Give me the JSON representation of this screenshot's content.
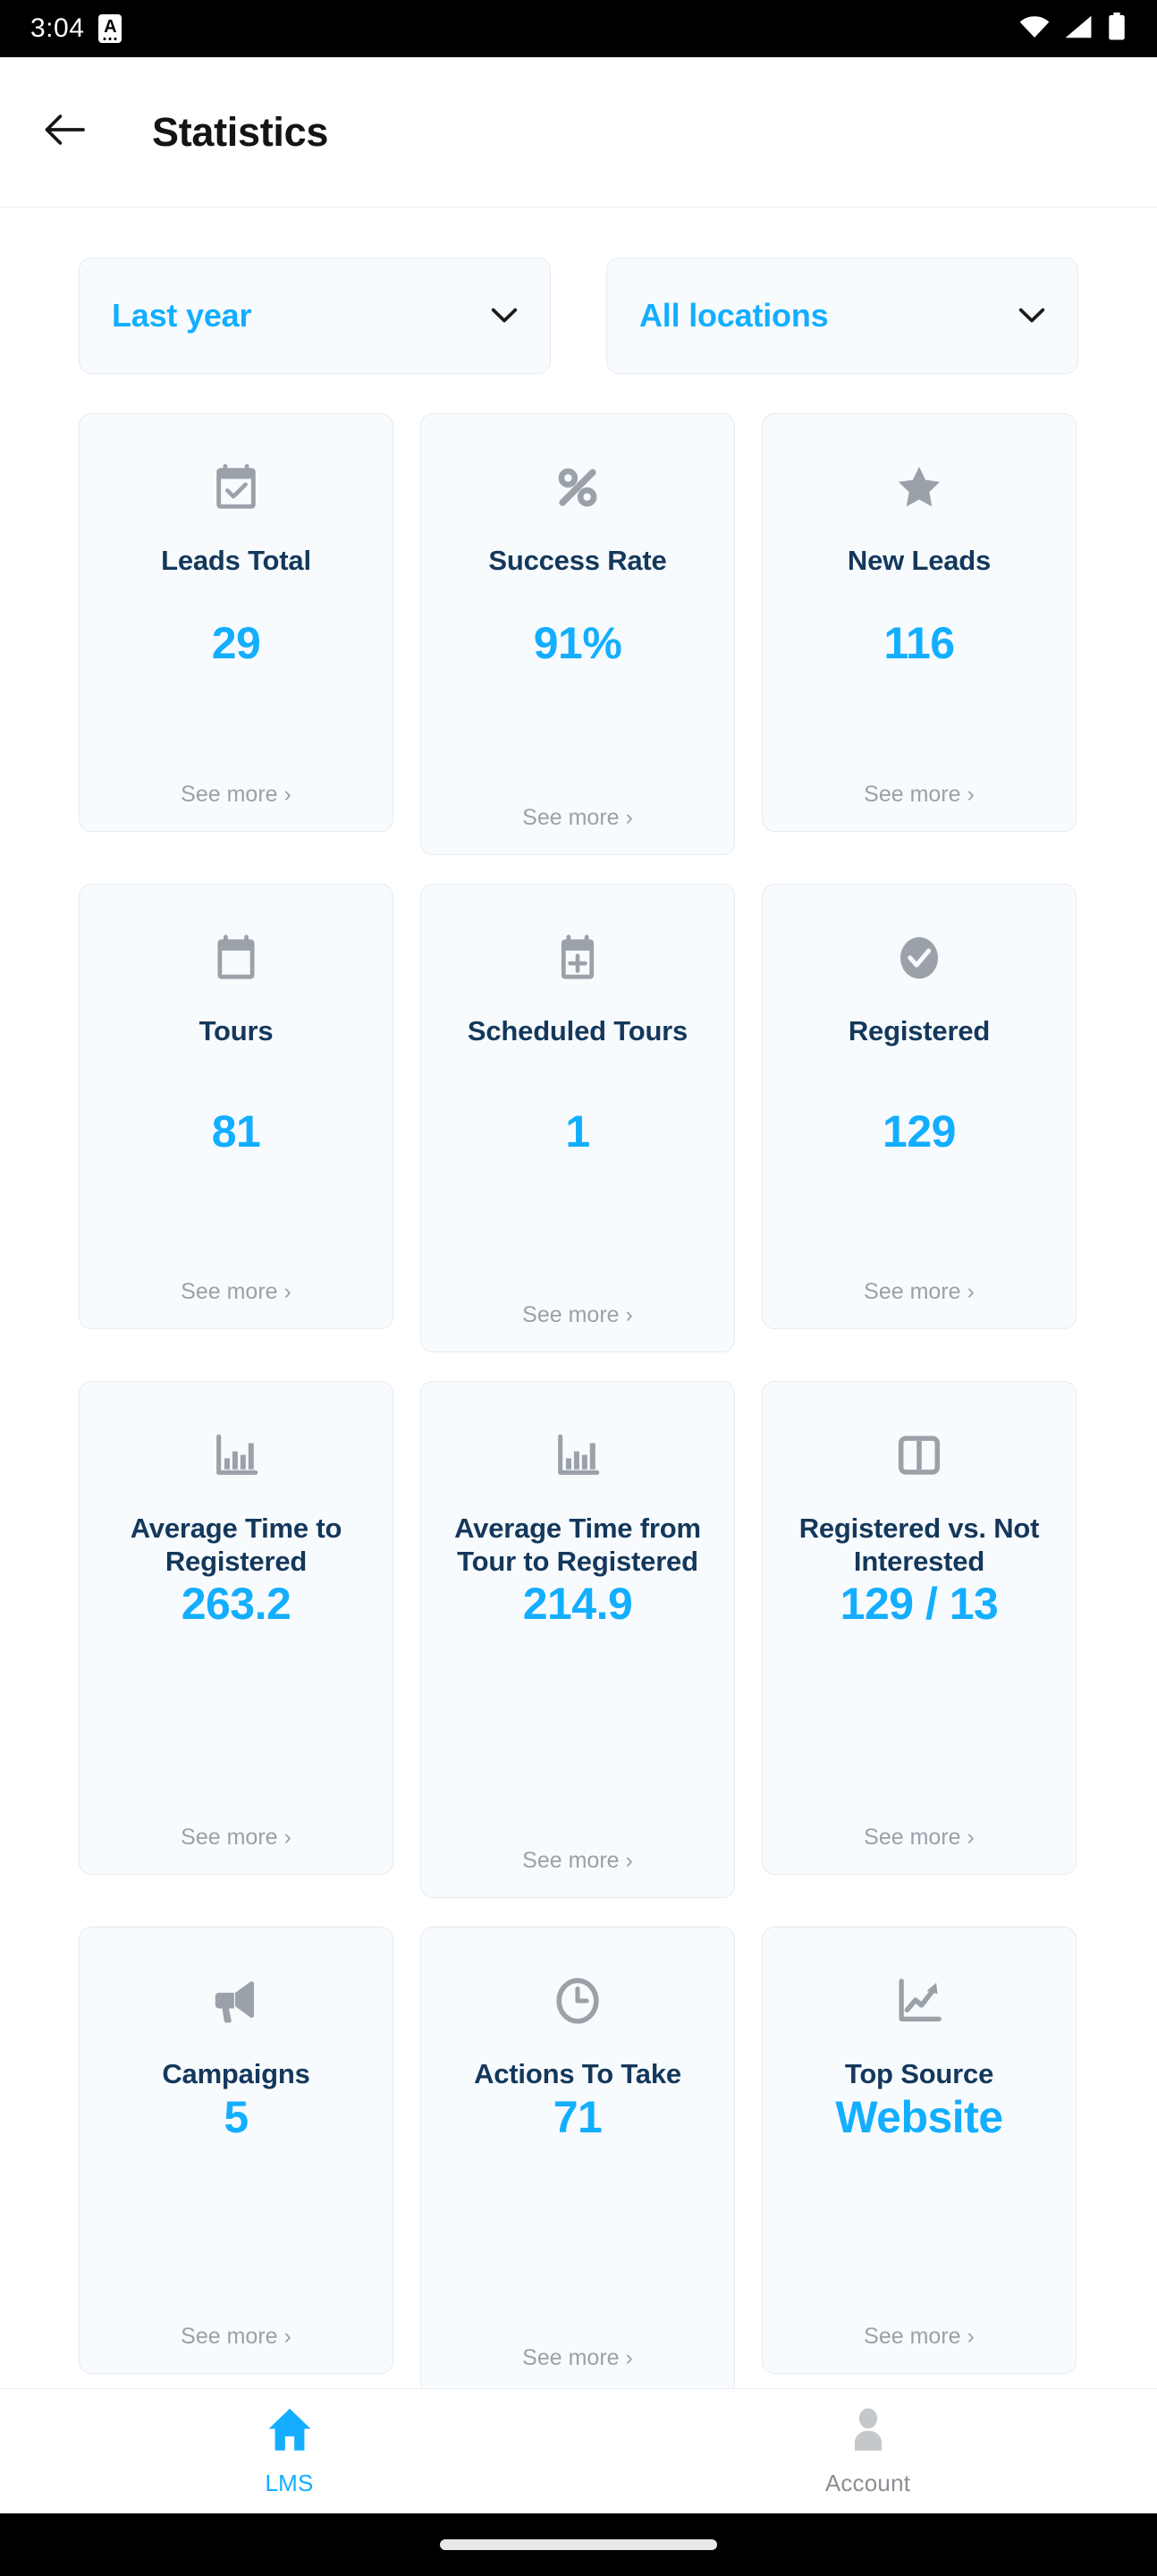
{
  "status_bar": {
    "time": "3:04",
    "badge_letter": "A",
    "icons": [
      "wifi-icon",
      "cellular-signal-icon",
      "battery-icon"
    ]
  },
  "header": {
    "back_icon": "back-arrow-icon",
    "title": "Statistics"
  },
  "filters": [
    {
      "label": "Last year",
      "icon": "chevron-down-icon"
    },
    {
      "label": "All locations",
      "icon": "chevron-down-icon"
    }
  ],
  "see_more_label": "See more ›",
  "cards": [
    {
      "title": "Leads Total",
      "value": "29",
      "icon": "calendar-check-icon"
    },
    {
      "title": "Success Rate",
      "value": "91%",
      "icon": "percent-icon"
    },
    {
      "title": "New Leads",
      "value": "116",
      "icon": "star-icon"
    },
    {
      "title": "Tours",
      "value": "81",
      "icon": "calendar-grid-icon"
    },
    {
      "title": "Scheduled Tours",
      "value": "1",
      "icon": "calendar-plus-icon"
    },
    {
      "title": "Registered",
      "value": "129",
      "icon": "check-circle-icon"
    },
    {
      "title": "Average Time to Registered",
      "value": "263.2",
      "icon": "bar-chart-icon"
    },
    {
      "title": "Average Time from Tour to Registered",
      "value": "214.9",
      "icon": "bar-chart-icon"
    },
    {
      "title": "Registered vs. Not Interested",
      "value": "129 / 13",
      "icon": "split-columns-icon"
    },
    {
      "title": "Campaigns",
      "value": "5",
      "icon": "megaphone-icon"
    },
    {
      "title": "Actions To Take",
      "value": "71",
      "icon": "clock-icon"
    },
    {
      "title": "Top Source",
      "value": "Website",
      "icon": "trending-up-icon"
    }
  ],
  "bottom_nav": [
    {
      "label": "LMS",
      "icon": "home-icon",
      "active": true
    },
    {
      "label": "Account",
      "icon": "person-icon",
      "active": false
    }
  ],
  "colors": {
    "accent_blue": "#13aeff",
    "title_navy": "#14385c",
    "icon_gray": "#9aa1a9",
    "card_bg": "#f8fbfd",
    "card_border": "#e7eaf0"
  }
}
